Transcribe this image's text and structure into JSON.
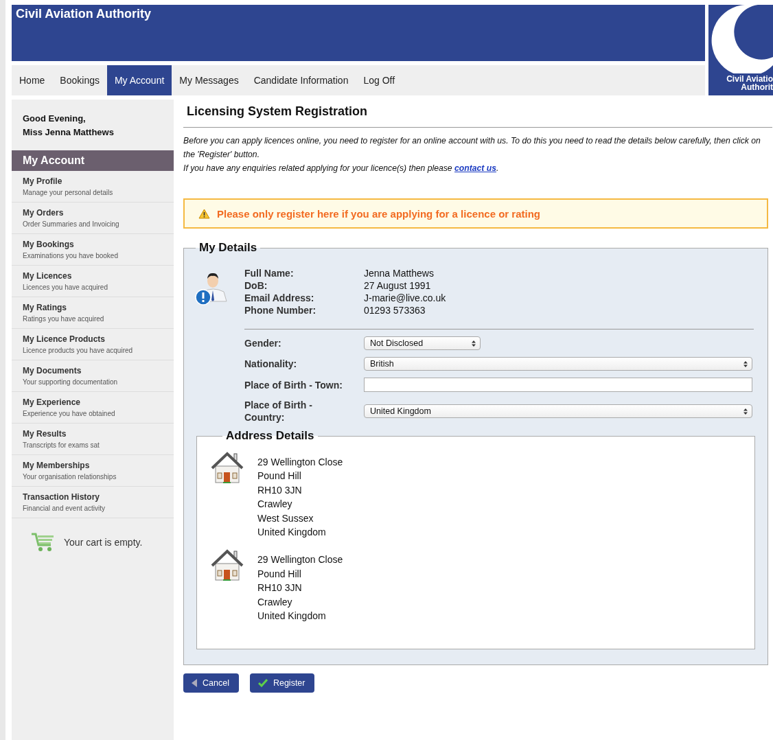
{
  "header": {
    "title": "Civil Aviation Authority",
    "logo_lines": [
      "Civil Aviatio",
      "Authorit"
    ]
  },
  "nav": [
    {
      "label": "Home",
      "selected": false
    },
    {
      "label": "Bookings",
      "selected": false
    },
    {
      "label": "My Account",
      "selected": true
    },
    {
      "label": "My Messages",
      "selected": false
    },
    {
      "label": "Candidate Information",
      "selected": false
    },
    {
      "label": "Log Off",
      "selected": false
    }
  ],
  "sidebar": {
    "greeting": [
      "Good Evening,",
      "Miss Jenna Matthews"
    ],
    "heading": "My Account",
    "items": [
      {
        "title": "My Profile",
        "subtitle": "Manage your personal details"
      },
      {
        "title": "My Orders",
        "subtitle": "Order Summaries and Invoicing"
      },
      {
        "title": "My Bookings",
        "subtitle": "Examinations you have booked"
      },
      {
        "title": "My Licences",
        "subtitle": "Licences you have acquired"
      },
      {
        "title": "My Ratings",
        "subtitle": "Ratings you have acquired"
      },
      {
        "title": "My Licence Products",
        "subtitle": "Licence products you have acquired"
      },
      {
        "title": "My Documents",
        "subtitle": "Your supporting documentation"
      },
      {
        "title": "My Experience",
        "subtitle": "Experience you have obtained"
      },
      {
        "title": "My Results",
        "subtitle": "Transcripts for exams sat"
      },
      {
        "title": "My Memberships",
        "subtitle": "Your organisation relationships"
      },
      {
        "title": "Transaction History",
        "subtitle": "Financial and event activity"
      }
    ],
    "cart": "Your cart is empty."
  },
  "main": {
    "title": "Licensing System Registration",
    "intro": "Before you can apply licences online, you need to register for an online account with us. To do this you need to read the details below carefully, then click on the 'Register' button.",
    "enquiry": {
      "text": "If you have any enquiries related applying for your licence(s) then please ",
      "link": "contact us",
      "after": "."
    },
    "warning": "Please only register here if you are applying for a licence or rating",
    "my_details": {
      "legend": "My Details",
      "info": [
        {
          "label": "Full Name:",
          "value": "Jenna Matthews"
        },
        {
          "label": "DoB:",
          "value": "27 August 1991"
        },
        {
          "label": "Email Address:",
          "value": "J-marie@live.co.uk"
        },
        {
          "label": "Phone Number:",
          "value": "01293 573363"
        }
      ],
      "fields": [
        {
          "label": "Gender:",
          "kind": "select",
          "value": "Not Disclosed"
        },
        {
          "label": "Nationality:",
          "kind": "select",
          "value": "British"
        },
        {
          "label": "Place of Birth - Town:",
          "kind": "text"
        },
        {
          "label": "Place of Birth - Country:",
          "kind": "select",
          "value": "United Kingdom"
        }
      ]
    },
    "address_details": {
      "legend": "Address Details",
      "addresses": [
        [
          "29 Wellington Close",
          "Pound Hill",
          "RH10 3JN",
          "Crawley",
          "West Sussex",
          "United Kingdom"
        ],
        [
          "29 Wellington Close",
          "Pound Hill",
          "RH10 3JN",
          "Crawley",
          "United Kingdom"
        ]
      ]
    },
    "buttons": [
      {
        "label": "Cancel",
        "kind": "back"
      },
      {
        "label": "Register",
        "kind": "confirm"
      }
    ]
  }
}
